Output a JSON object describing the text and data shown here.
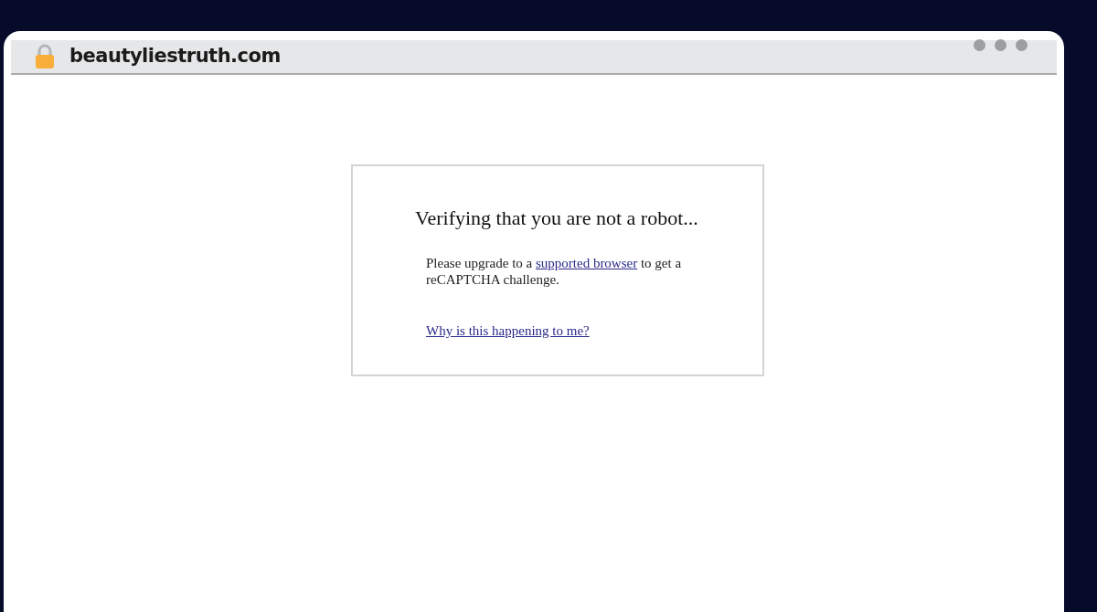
{
  "address_bar": {
    "url": "beautyliestruth.com",
    "secure": true
  },
  "dialog": {
    "title": "Verifying that you are not a robot...",
    "message": {
      "before": "Please upgrade to a ",
      "link": "supported browser",
      "after": " to get a reCAPTCHA challenge."
    },
    "help_link": "Why is this happening to me?"
  }
}
